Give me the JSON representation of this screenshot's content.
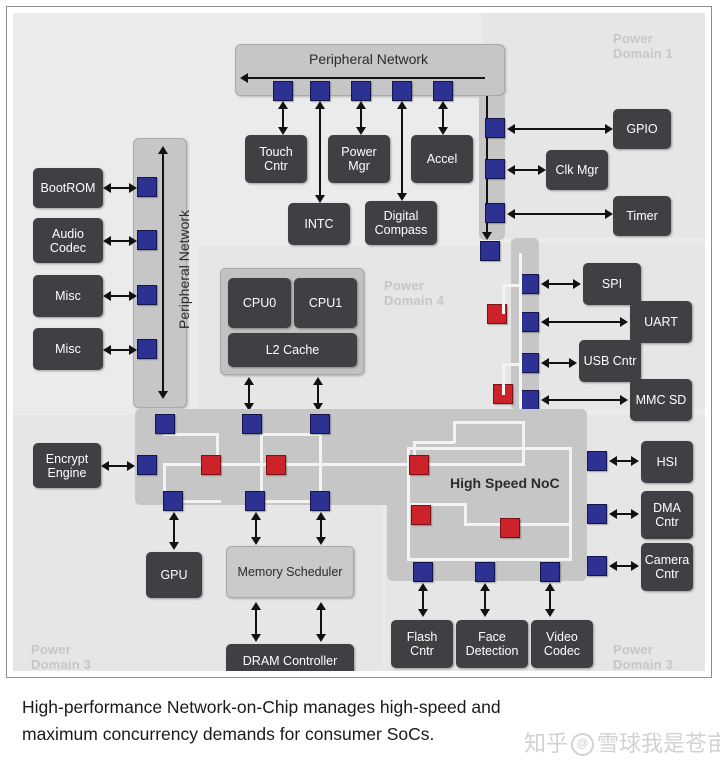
{
  "figure": {
    "caption": "High-performance Network-on-Chip manages high-speed and\nmaximum concurrency demands for consumer SoCs.",
    "watermark": {
      "prefix": "知乎",
      "at": "@",
      "handle": "雪球我是苍亩"
    }
  },
  "colors": {
    "network_interface": "#2d3192",
    "router": "#cc2229",
    "block": "#3f4043",
    "bus": "#c6c6c6",
    "panel": "#ebebeb",
    "wire": "#f3f3f3",
    "domain_label": "#c6c6c6"
  },
  "power_domains": [
    {
      "id": "pd1",
      "label": "Power\nDomain 1"
    },
    {
      "id": "pd4",
      "label": "Power\nDomain 4"
    },
    {
      "id": "pd3_left",
      "label": "Power\nDomain 3"
    },
    {
      "id": "pd3_right",
      "label": "Power\nDomain 3"
    }
  ],
  "networks": [
    {
      "id": "periph_top",
      "label": "Peripheral Network",
      "orientation": "horizontal",
      "ports": 5
    },
    {
      "id": "periph_left",
      "label": "Peripheral Network",
      "orientation": "vertical",
      "ports": 4
    },
    {
      "id": "noc",
      "label": "High Speed NoC",
      "orientation": "mesh"
    }
  ],
  "blocks": {
    "left_column": [
      {
        "id": "bootrom",
        "label": "BootROM"
      },
      {
        "id": "audio_codec",
        "label": "Audio\nCodec"
      },
      {
        "id": "misc_1",
        "label": "Misc"
      },
      {
        "id": "misc_2",
        "label": "Misc"
      }
    ],
    "top_row": [
      {
        "id": "touch_cntr",
        "label": "Touch\nCntr"
      },
      {
        "id": "power_mgr",
        "label": "Power\nMgr"
      },
      {
        "id": "accel",
        "label": "Accel"
      }
    ],
    "top_row_2": [
      {
        "id": "intc",
        "label": "INTC"
      },
      {
        "id": "digital_compass",
        "label": "Digital\nCompass"
      }
    ],
    "pd1_column": [
      {
        "id": "gpio",
        "label": "GPIO"
      },
      {
        "id": "clk_mgr",
        "label": "Clk Mgr"
      },
      {
        "id": "timer",
        "label": "Timer"
      }
    ],
    "cpu_cluster": {
      "id": "cpu_cluster",
      "cores": [
        {
          "id": "cpu0",
          "label": "CPU0"
        },
        {
          "id": "cpu1",
          "label": "CPU1"
        }
      ],
      "cache": {
        "id": "l2_cache",
        "label": "L2 Cache"
      }
    },
    "io_column": [
      {
        "id": "spi",
        "label": "SPI"
      },
      {
        "id": "uart",
        "label": "UART"
      },
      {
        "id": "usb_cntr",
        "label": "USB Cntr"
      },
      {
        "id": "mmc_sd",
        "label": "MMC SD"
      }
    ],
    "hs_column": [
      {
        "id": "hsi",
        "label": "HSI"
      },
      {
        "id": "dma_cntr",
        "label": "DMA\nCntr"
      },
      {
        "id": "camera_cntr",
        "label": "Camera\nCntr"
      }
    ],
    "bottom_row": [
      {
        "id": "flash_cntr",
        "label": "Flash\nCntr"
      },
      {
        "id": "face_detection",
        "label": "Face\nDetection"
      },
      {
        "id": "video_codec",
        "label": "Video\nCodec"
      }
    ],
    "memory": [
      {
        "id": "encrypt_engine",
        "label": "Encrypt\nEngine"
      },
      {
        "id": "gpu",
        "label": "GPU"
      },
      {
        "id": "memory_scheduler",
        "label": "Memory Scheduler"
      },
      {
        "id": "dram_controller",
        "label": "DRAM Controller"
      }
    ]
  }
}
